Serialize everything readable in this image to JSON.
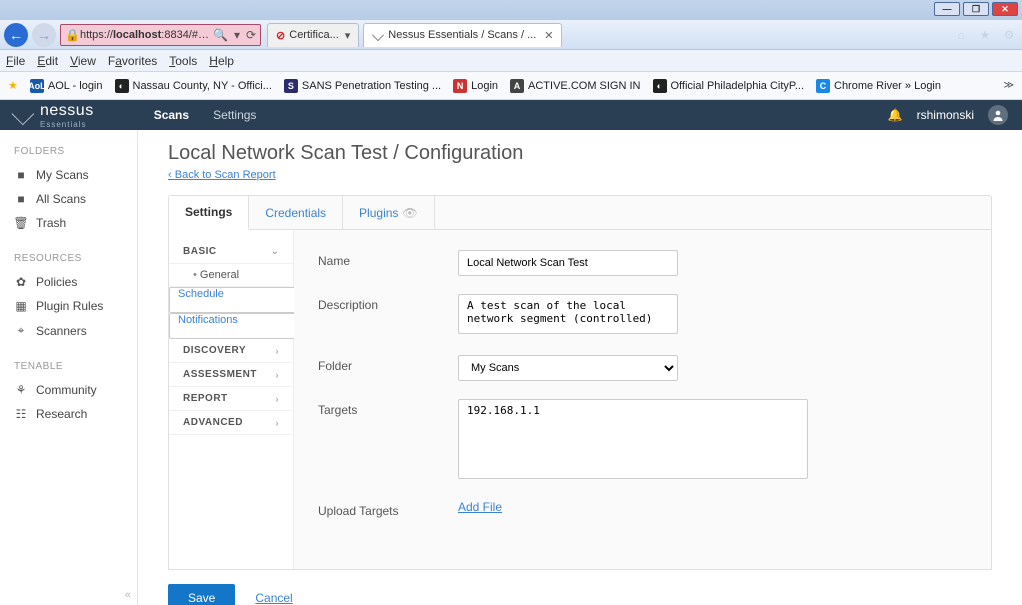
{
  "window": {
    "min": "—",
    "max": "❐",
    "close": "✕"
  },
  "browser": {
    "url_prefix": "https://",
    "url_host": "localhost",
    "url_suffix": ":8834/#…",
    "cert_tab": "Certifica...",
    "tab_title": "Nessus Essentials / Scans / ...",
    "home_icon": "⌂",
    "star_icon": "★",
    "gear_icon": "⚙"
  },
  "menu": {
    "file": "File",
    "edit": "Edit",
    "view": "View",
    "favorites": "Favorites",
    "tools": "Tools",
    "help": "Help"
  },
  "favorites": [
    {
      "icon": "AoL",
      "bg": "#1659a7",
      "fg": "#fff",
      "label": "AOL - login"
    },
    {
      "icon": "◐",
      "bg": "#222",
      "fg": "#fff",
      "label": "Nassau County, NY - Offici..."
    },
    {
      "icon": "S",
      "bg": "#2d2a6e",
      "fg": "#fff",
      "label": "SANS Penetration Testing ..."
    },
    {
      "icon": "N",
      "bg": "#c33",
      "fg": "#fff",
      "label": "Login"
    },
    {
      "icon": "A",
      "bg": "#444",
      "fg": "#fff",
      "label": "ACTIVE.COM  SIGN IN"
    },
    {
      "icon": "◐",
      "bg": "#222",
      "fg": "#fff",
      "label": "Official Philadelphia CityP..."
    },
    {
      "icon": "C",
      "bg": "#1b87e5",
      "fg": "#fff",
      "label": "Chrome River » Login"
    }
  ],
  "header": {
    "product": "nessus",
    "edition": "Essentials",
    "nav": [
      "Scans",
      "Settings"
    ],
    "active": 0,
    "bell": "🔔",
    "user": "rshimonski"
  },
  "sidebar": {
    "folders_title": "FOLDERS",
    "folders": [
      {
        "icon": "■",
        "label": "My Scans"
      },
      {
        "icon": "■",
        "label": "All Scans"
      },
      {
        "icon": "🗑",
        "label": "Trash"
      }
    ],
    "resources_title": "RESOURCES",
    "resources": [
      {
        "icon": "✿",
        "label": "Policies"
      },
      {
        "icon": "▦",
        "label": "Plugin Rules"
      },
      {
        "icon": "⌖",
        "label": "Scanners"
      }
    ],
    "tenable_title": "TENABLE",
    "tenable": [
      {
        "icon": "⚘",
        "label": "Community"
      },
      {
        "icon": "☷",
        "label": "Research"
      }
    ]
  },
  "page": {
    "title": "Local Network Scan Test / Configuration",
    "back": "Back to Scan Report"
  },
  "tabs": {
    "settings": "Settings",
    "credentials": "Credentials",
    "plugins": "Plugins"
  },
  "leftMenu": {
    "basic": "BASIC",
    "general": "General",
    "schedule": "Schedule",
    "notifications": "Notifications",
    "discovery": "DISCOVERY",
    "assessment": "ASSESSMENT",
    "report": "REPORT",
    "advanced": "ADVANCED"
  },
  "form": {
    "name_label": "Name",
    "name_value": "Local Network Scan Test",
    "desc_label": "Description",
    "desc_value": "A test scan of the local network segment (controlled)",
    "folder_label": "Folder",
    "folder_value": "My Scans",
    "targets_label": "Targets",
    "targets_value": "192.168.1.1",
    "upload_label": "Upload Targets",
    "addfile": "Add File"
  },
  "actions": {
    "save": "Save",
    "cancel": "Cancel"
  }
}
